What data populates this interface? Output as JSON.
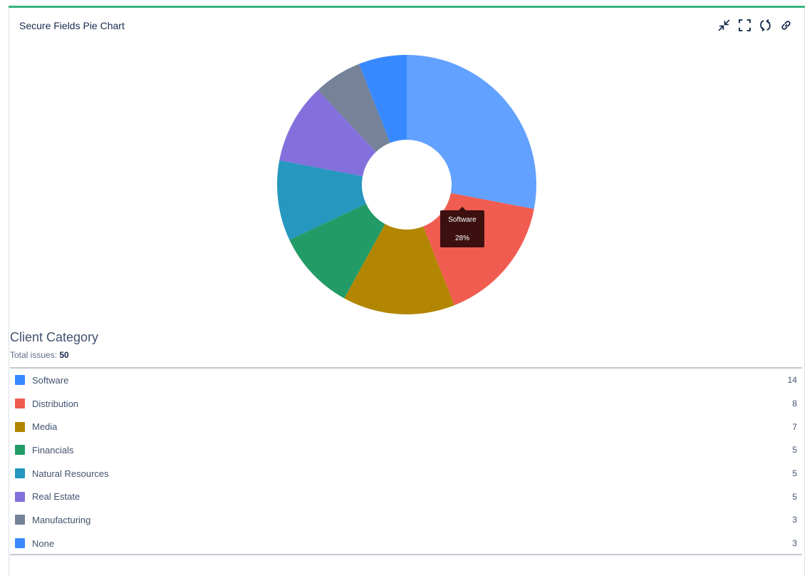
{
  "gadget": {
    "title": "Secure Fields Pie Chart",
    "accent_color": "#36b37e",
    "toolbar": [
      {
        "name": "minimize-icon"
      },
      {
        "name": "fullscreen-icon"
      },
      {
        "name": "refresh-icon"
      },
      {
        "name": "link-icon"
      }
    ]
  },
  "tooltip": {
    "label": "Software",
    "value": "28%"
  },
  "legend": {
    "title": "Client Category",
    "total_label": "Total issues:",
    "total_value": "50"
  },
  "chart_data": {
    "type": "pie",
    "donut": true,
    "title": "Client Category",
    "total": 50,
    "categories": [
      "Software",
      "Distribution",
      "Media",
      "Financials",
      "Natural Resources",
      "Real Estate",
      "Manufacturing",
      "None"
    ],
    "values": [
      14,
      8,
      7,
      5,
      5,
      5,
      3,
      3
    ],
    "colors": [
      "#62a1ff",
      "#f15c51",
      "#b28600",
      "#239b67",
      "#2697be",
      "#8470dc",
      "#758298",
      "#3889ff"
    ],
    "legend_colors": [
      "#3889ff",
      "#f15c51",
      "#b28600",
      "#239b67",
      "#2697be",
      "#8470dc",
      "#758298",
      "#3889ff"
    ]
  }
}
